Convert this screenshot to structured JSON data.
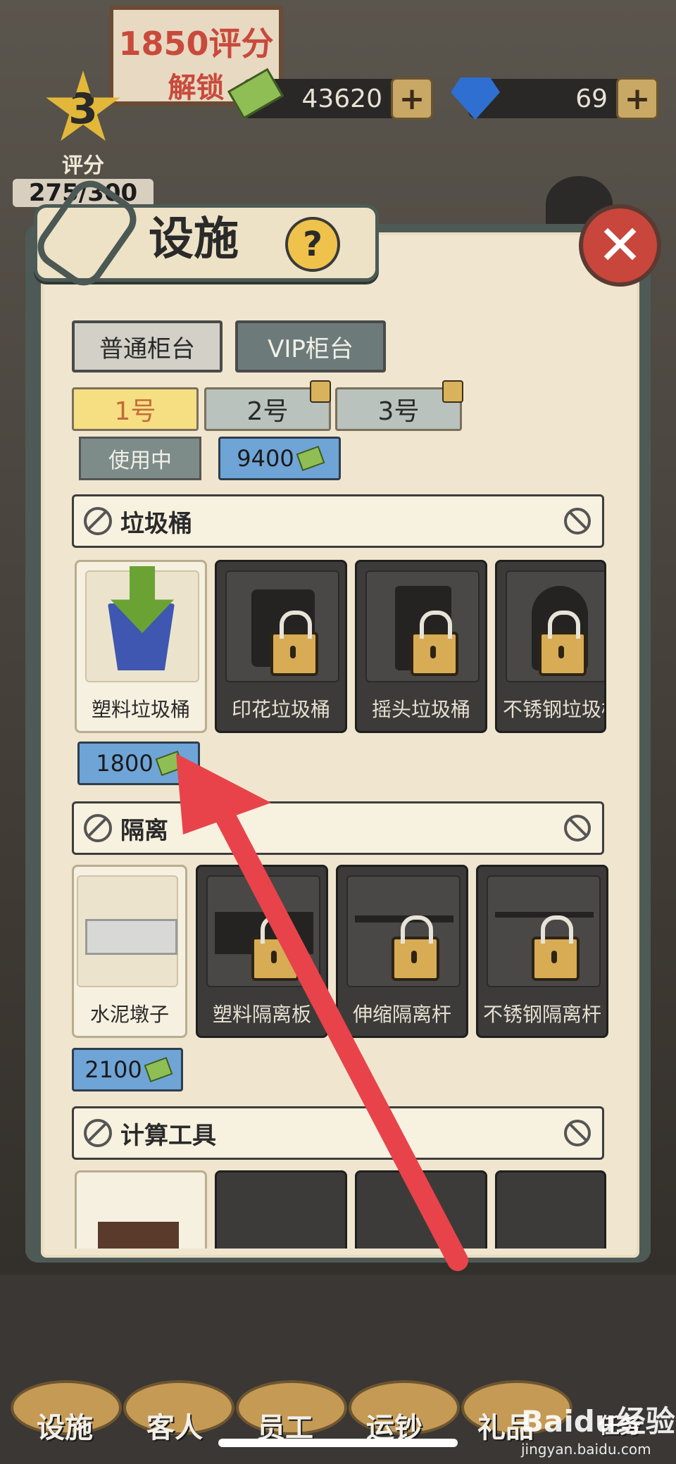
{
  "hud": {
    "unlock_sign_line1": "1850评分",
    "unlock_sign_line2": "解锁",
    "cash": "43620",
    "diamonds": "69",
    "rating_level": "3",
    "rating_label": "评分",
    "rating_progress": "275/300"
  },
  "dialog": {
    "title": "设施",
    "help": "?",
    "close": "✕",
    "counter_tabs": [
      "普通柜台",
      "VIP柜台"
    ],
    "counter_numbers": [
      "1号",
      "2号",
      "3号"
    ],
    "status_in_use": "使用中",
    "unlock_price": "9400"
  },
  "sections": [
    {
      "name": "垃圾桶",
      "items": [
        {
          "label": "塑料垃圾桶",
          "locked": false
        },
        {
          "label": "印花垃圾桶",
          "locked": true
        },
        {
          "label": "摇头垃圾桶",
          "locked": true
        },
        {
          "label": "不锈钢垃圾桶",
          "locked": true
        }
      ],
      "price": "1800"
    },
    {
      "name": "隔离",
      "items": [
        {
          "label": "水泥墩子",
          "locked": false
        },
        {
          "label": "塑料隔离板",
          "locked": true
        },
        {
          "label": "伸缩隔离杆",
          "locked": true
        },
        {
          "label": "不锈钢隔离杆",
          "locked": true
        }
      ],
      "price": "2100"
    },
    {
      "name": "计算工具"
    }
  ],
  "bottom_nav": [
    "设施",
    "客人",
    "员工",
    "运钞",
    "礼品",
    "任务"
  ],
  "watermark": {
    "brand": "Baidu经验",
    "url": "jingyan.baidu.com"
  },
  "colors": {
    "annotation_arrow": "#e8434a",
    "selected_tab": "#f5df82",
    "price_tag": "#6fa4d6"
  }
}
